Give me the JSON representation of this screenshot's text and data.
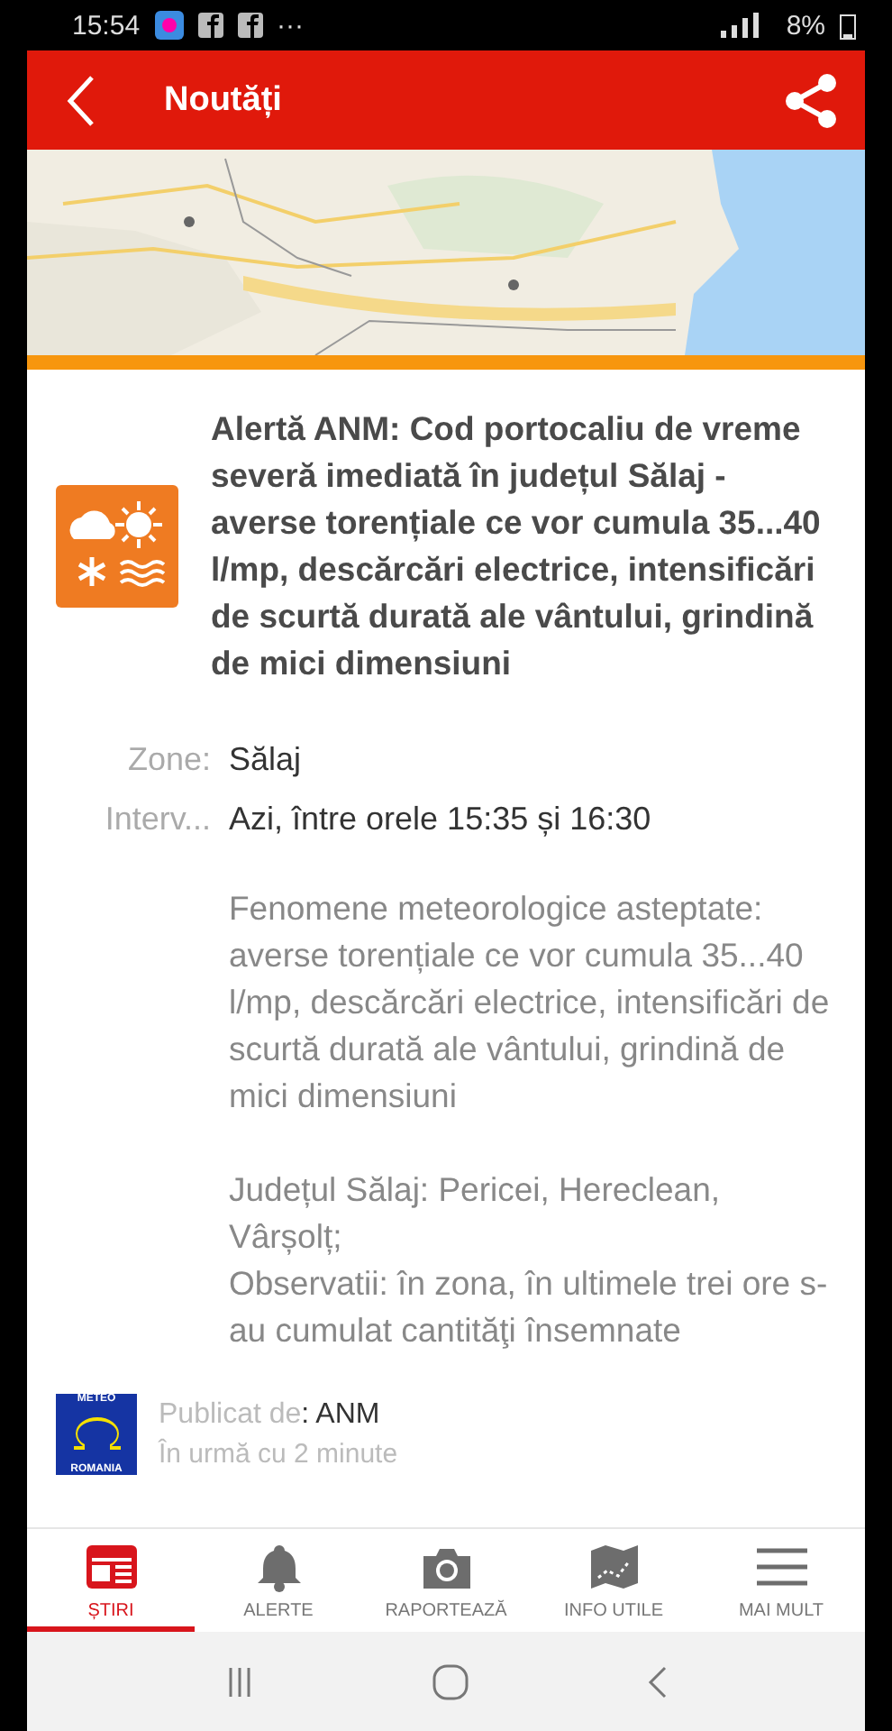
{
  "status_bar": {
    "time": "15:54",
    "more": "···",
    "battery": "8%"
  },
  "header": {
    "title": "Noutăți"
  },
  "alert": {
    "title": "Alertă ANM: Cod portocaliu de vreme severă imediată în județul Sălaj - averse torențiale ce vor cumula 35...40 l/mp, descărcări electrice, intensificări de scurtă durată ale vântului, grindină de mici dimensiuni",
    "fields": [
      {
        "label": "Zone:",
        "value": "Sălaj"
      },
      {
        "label": "Interv...",
        "value": "Azi, între orele 15:35 și 16:30"
      }
    ],
    "paragraphs": [
      "Fenomene meteorologice asteptate: averse torențiale ce vor cumula 35...40 l/mp, descărcări electrice, intensificări de scurtă durată ale vântului, grindină de mici dimensiuni",
      "Județul Sălaj: Pericei, Hereclean, Vârșolț;\nObservatii: în zona, în ultimele trei  ore s-au cumulat cantităţi însemnate"
    ]
  },
  "publisher": {
    "logo_top": "METEO",
    "logo_bottom": "ROMANIA",
    "label": "Publicat de",
    "name": ": ANM",
    "time": "În urmă cu 2 minute"
  },
  "bottom_nav": [
    {
      "label": "ȘTIRI",
      "kind": "news",
      "selected": true
    },
    {
      "label": "ALERTE",
      "kind": "bell",
      "selected": false
    },
    {
      "label": "RAPORTEAZĂ",
      "kind": "camera",
      "selected": false
    },
    {
      "label": "INFO UTILE",
      "kind": "map",
      "selected": false
    },
    {
      "label": "MAI MULT",
      "kind": "menu",
      "selected": false
    }
  ]
}
